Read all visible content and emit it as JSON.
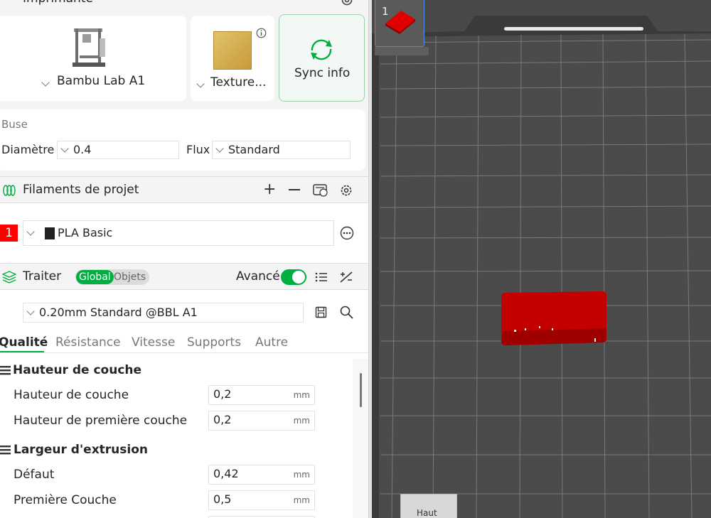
{
  "printer": {
    "title": "Imprimante",
    "model": "Bambu Lab A1",
    "plate": "Texture...",
    "sync_label": "Sync info"
  },
  "nozzle": {
    "section_label": "Buse",
    "diameter_label": "Diamètre",
    "diameter_value": "0.4",
    "flow_label": "Flux",
    "flow_value": "Standard"
  },
  "filaments": {
    "title": "Filaments de projet",
    "items": [
      {
        "index": "1",
        "name": "PLA Basic",
        "color": "#ff0000"
      }
    ]
  },
  "process": {
    "title": "Traiter",
    "toggle_global": "Global",
    "toggle_objects": "Objets",
    "advanced_label": "Avancé",
    "preset": "0.20mm Standard @BBL A1",
    "tabs": [
      "Qualité",
      "Résistance",
      "Vitesse",
      "Supports",
      "Autre"
    ],
    "active_tab": "Qualité",
    "groups": [
      {
        "title": "Hauteur de couche",
        "params": [
          {
            "label": "Hauteur de couche",
            "value": "0,2",
            "unit": "mm"
          },
          {
            "label": "Hauteur de première couche",
            "value": "0,2",
            "unit": "mm"
          }
        ]
      },
      {
        "title": "Largeur d'extrusion",
        "params": [
          {
            "label": "Défaut",
            "value": "0,42",
            "unit": "mm"
          },
          {
            "label": "Première Couche",
            "value": "0,5",
            "unit": "mm"
          }
        ]
      }
    ]
  },
  "viewport": {
    "plate_number": "1",
    "view_label": "Haut",
    "model_color": "#cc0000",
    "bed_color": "#4b4b4b",
    "accent": "#00ae42"
  }
}
